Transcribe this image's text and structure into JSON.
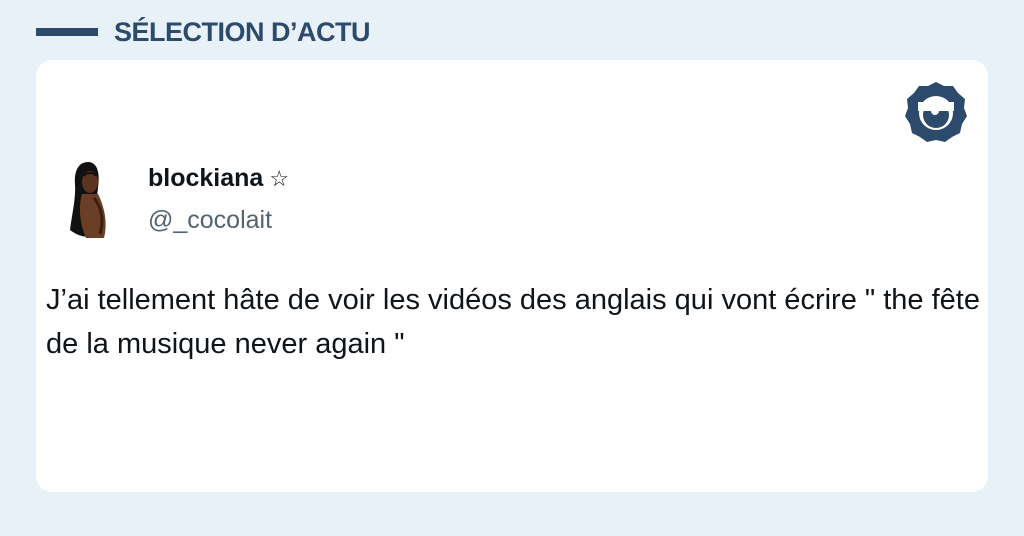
{
  "header": {
    "title": "SÉLECTION D’ACTU"
  },
  "tweet": {
    "display_name": "blockiana",
    "badge": "☆",
    "handle": "@_cocolait",
    "text": "J’ai tellement hâte de voir les vidéos des anglais qui vont écrire \" the fête de la musique never again \""
  },
  "icons": {
    "brand_logo": "eye-badge-icon",
    "avatar": "user-avatar",
    "badge": "star-icon"
  },
  "colors": {
    "background": "#e9f1f8",
    "accent": "#2c4a6b",
    "card": "#ffffff",
    "text": "#0f1419",
    "muted": "#536471"
  }
}
